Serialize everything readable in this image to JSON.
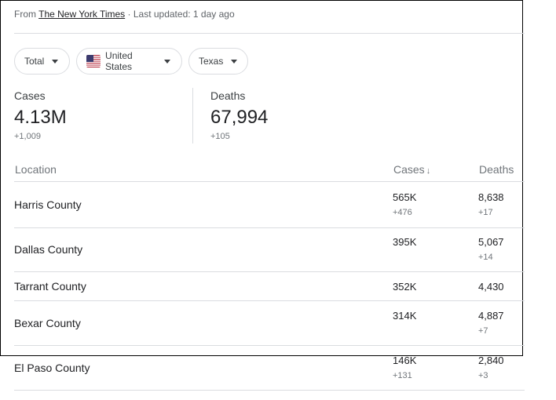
{
  "source": {
    "prefix": "From",
    "publisher": "The New York Times",
    "updated": "· Last updated: 1 day ago"
  },
  "filters": {
    "metric": "Total",
    "country": "United States",
    "region": "Texas",
    "country_flag_icon": "us-flag-icon"
  },
  "summary": {
    "cases_label": "Cases",
    "cases_value": "4.13M",
    "cases_delta": "+1,009",
    "deaths_label": "Deaths",
    "deaths_value": "67,994",
    "deaths_delta": "+105"
  },
  "table": {
    "headers": {
      "location": "Location",
      "cases": "Cases",
      "deaths": "Deaths",
      "sort_icon": "arrow-down-icon"
    },
    "rows": [
      {
        "location": "Harris County",
        "cases": "565K",
        "cases_delta": "+476",
        "deaths": "8,638",
        "deaths_delta": "+17"
      },
      {
        "location": "Dallas County",
        "cases": "395K",
        "cases_delta": "",
        "deaths": "5,067",
        "deaths_delta": "+14"
      },
      {
        "location": "Tarrant County",
        "cases": "352K",
        "cases_delta": "",
        "deaths": "4,430",
        "deaths_delta": ""
      },
      {
        "location": "Bexar County",
        "cases": "314K",
        "cases_delta": "",
        "deaths": "4,887",
        "deaths_delta": "+7"
      },
      {
        "location": "El Paso County",
        "cases": "146K",
        "cases_delta": "+131",
        "deaths": "2,840",
        "deaths_delta": "+3"
      }
    ]
  }
}
